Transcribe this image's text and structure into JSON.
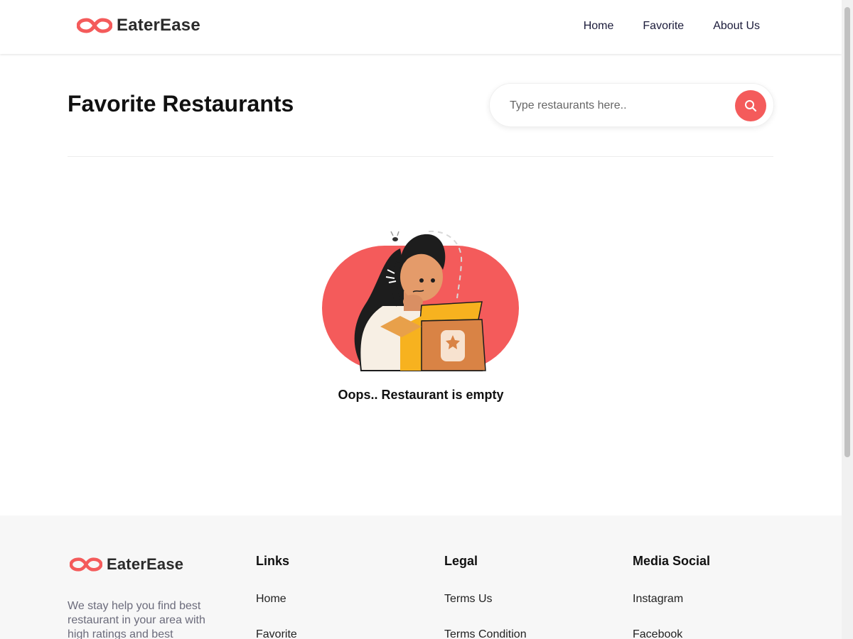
{
  "header": {
    "brand": "EaterEase",
    "nav": [
      {
        "label": "Home"
      },
      {
        "label": "Favorite"
      },
      {
        "label": "About Us"
      }
    ]
  },
  "main": {
    "title": "Favorite Restaurants",
    "search": {
      "placeholder": "Type restaurants here.."
    },
    "empty_message": "Oops.. Restaurant is empty"
  },
  "footer": {
    "brand": "EaterEase",
    "description": "We stay help you find best restaurant in your area with high ratings and best",
    "columns": [
      {
        "title": "Links",
        "items": [
          "Home",
          "Favorite"
        ]
      },
      {
        "title": "Legal",
        "items": [
          "Terms Us",
          "Terms Condition"
        ]
      },
      {
        "title": "Media Social",
        "items": [
          "Instagram",
          "Facebook"
        ]
      }
    ]
  },
  "colors": {
    "accent": "#f45b5b",
    "brand_text": "#2b2b2b",
    "footer_bg": "#f7f7f7"
  },
  "icons": {
    "logo": "infinity-logo-icon",
    "search": "search-icon"
  }
}
